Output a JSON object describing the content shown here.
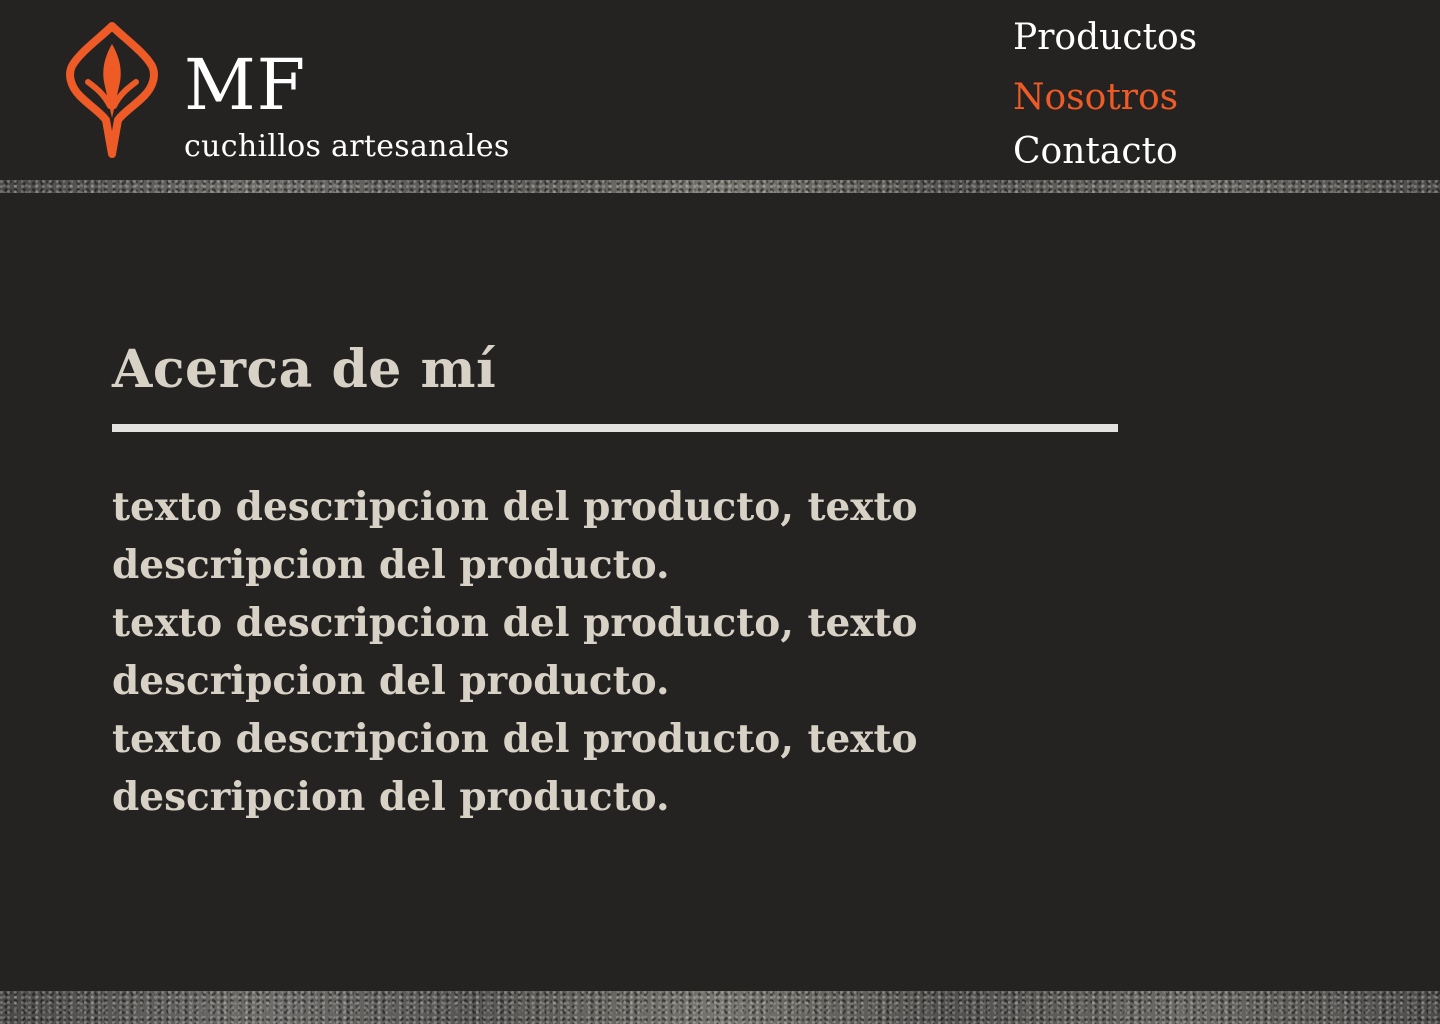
{
  "brand": {
    "name": "MF",
    "tagline": "cuchillos artesanales",
    "logo_icon": "knife-shield-icon",
    "accent_color": "#ee5b26"
  },
  "nav": {
    "items": [
      {
        "label": "Productos",
        "active": false
      },
      {
        "label": "Nosotros",
        "active": true
      },
      {
        "label": "Contacto",
        "active": false
      }
    ]
  },
  "about": {
    "title": "Acerca de mí",
    "lines": [
      "texto descripcion del producto, texto",
      "descripcion del producto.",
      "texto descripcion del producto, texto",
      "descripcion del producto.",
      "texto descripcion del producto, texto",
      "descripcion del producto."
    ]
  },
  "colors": {
    "background": "#242322",
    "text_light": "#d8d1c5",
    "white": "#ffffff",
    "accent": "#ee5b26"
  }
}
